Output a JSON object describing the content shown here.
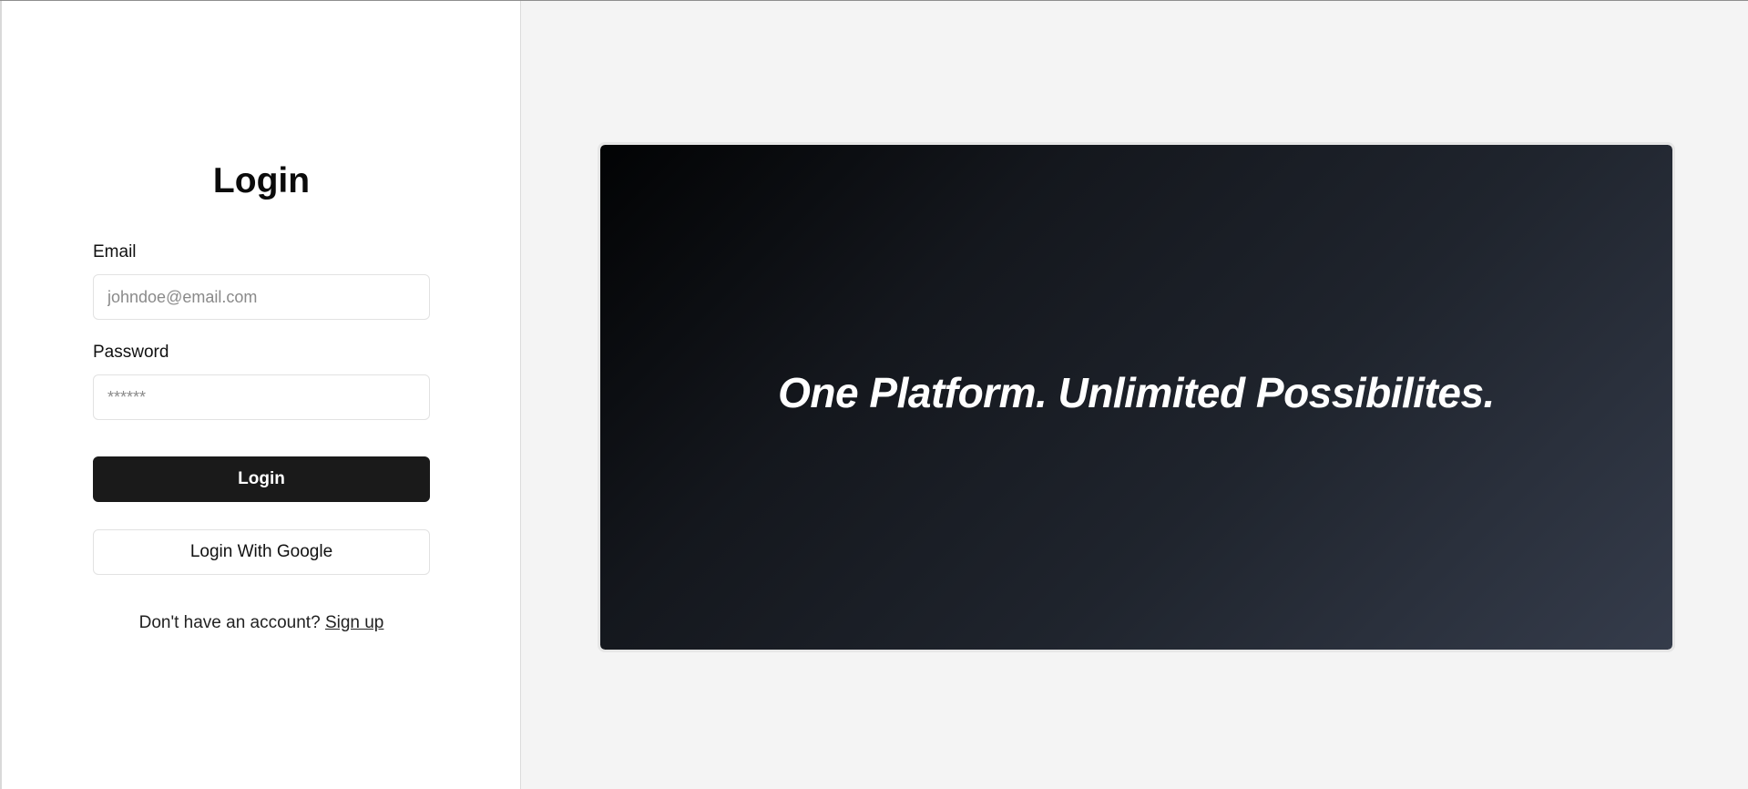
{
  "login": {
    "title": "Login",
    "email_label": "Email",
    "email_placeholder": "johndoe@email.com",
    "password_label": "Password",
    "password_placeholder": "******",
    "login_button": "Login",
    "google_button": "Login With Google",
    "signup_prompt": "Don't have an account?",
    "signup_link": "Sign up"
  },
  "hero": {
    "tagline": "One Platform. Unlimited Possibilites."
  },
  "colors": {
    "primary_button": "#1a1a1a",
    "left_background": "#ffffff",
    "right_background": "#f4f4f4"
  }
}
